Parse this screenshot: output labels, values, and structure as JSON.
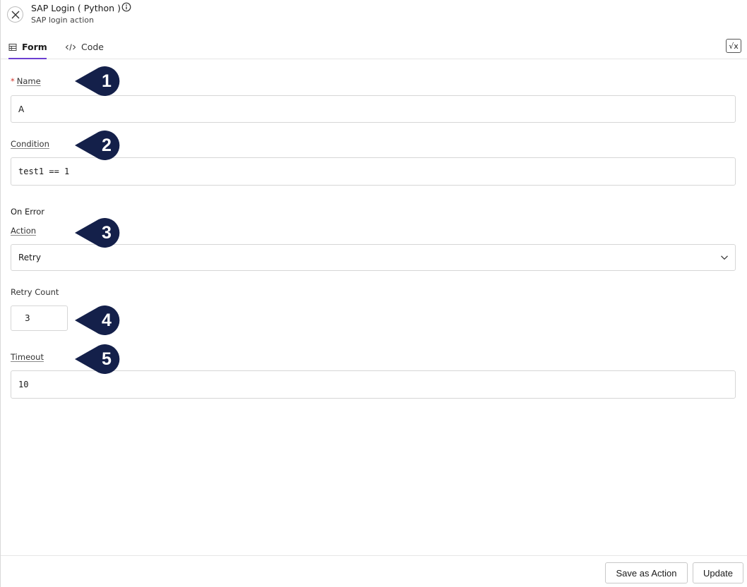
{
  "header": {
    "title": "SAP Login ( Python )",
    "subtitle": "SAP login action"
  },
  "tabs": [
    {
      "label": "Form",
      "active": true
    },
    {
      "label": "Code",
      "active": false
    }
  ],
  "toolbar": {
    "formula_label": "√x"
  },
  "form": {
    "name": {
      "label": "Name",
      "required_marker": "*",
      "value": "A"
    },
    "condition": {
      "label": "Condition",
      "value": "test1 == 1"
    },
    "on_error": {
      "section_label": "On Error",
      "action": {
        "label": "Action",
        "value": "Retry"
      },
      "retry_count": {
        "label": "Retry Count",
        "value": "3"
      }
    },
    "timeout": {
      "label": "Timeout",
      "value": "10"
    }
  },
  "callouts": [
    "1",
    "2",
    "3",
    "4",
    "5"
  ],
  "footer": {
    "save_as_action_label": "Save as Action",
    "update_label": "Update"
  },
  "colors": {
    "accent": "#6c3fd1",
    "callout": "#14204a",
    "required": "#d0342c"
  },
  "icons": [
    "close-icon",
    "info-icon",
    "table-icon",
    "code-icon",
    "formula-icon",
    "chevron-down-icon"
  ]
}
